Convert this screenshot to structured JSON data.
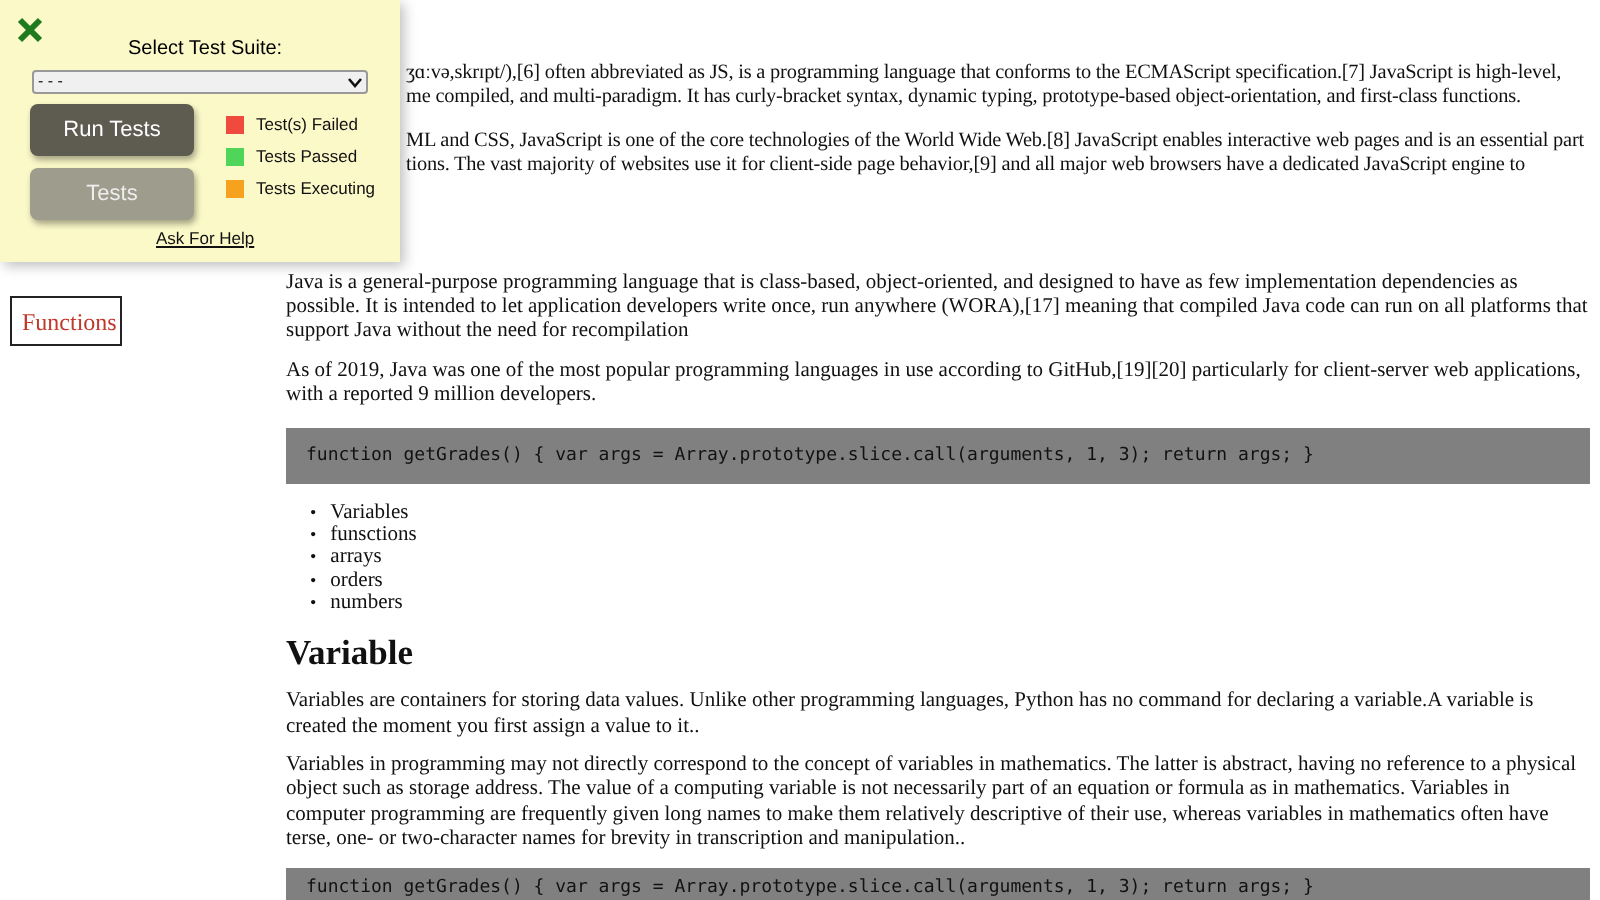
{
  "panel": {
    "title": "Select Test Suite:",
    "select": {
      "value": "- - -"
    },
    "buttons": [
      {
        "label": "Run Tests",
        "kind": "primary"
      },
      {
        "label": "Tests",
        "kind": "secondary"
      }
    ],
    "legend": [
      {
        "label": "Test(s) Failed",
        "color": "#f04a3e"
      },
      {
        "label": "Tests Passed",
        "color": "#4fd65a"
      },
      {
        "label": "Tests Executing",
        "color": "#f6a21e"
      }
    ],
    "help_link": "Ask For Help"
  },
  "sidebar": {
    "items": [
      {
        "label": "Functions"
      }
    ]
  },
  "intro": [
    {
      "lines": [
        "ʒɑːvə,skrɪpt/),[6] often abbreviated as JS, is a programming language that conforms to the ECMAScript specification.[7] JavaScript is high-level,",
        "me compiled, and multi-paradigm. It has curly-bracket syntax, dynamic typing, prototype-based object-orientation, and first-class functions."
      ]
    },
    {
      "lines": [
        "ML and CSS, JavaScript is one of the core technologies of the World Wide Web.[8] JavaScript enables interactive web pages and is an essential part",
        "tions. The vast majority of websites use it for client-side page behavior,[9] and all major web browsers have a dedicated JavaScript engine to"
      ]
    }
  ],
  "java": {
    "paragraphs": [
      "Java is a general-purpose programming language that is class-based, object-oriented, and designed to have as few implementation dependencies as possible. It is intended to let application developers write once, run anywhere (WORA),[17] meaning that compiled Java code can run on all platforms that support Java without the need for recompilation",
      "As of 2019, Java was one of the most popular programming languages in use according to GitHub,[19][20] particularly for client-server web applications, with a reported 9 million developers."
    ],
    "code": "function getGrades() { var args = Array.prototype.slice.call(arguments, 1, 3); return args; }",
    "list_marker": "•",
    "list": [
      "Variables",
      "funsctions",
      "arrays",
      "orders",
      "numbers"
    ]
  },
  "variable": {
    "heading": "Variable",
    "paragraphs": [
      "Variables are containers for storing data values. Unlike other programming languages, Python has no command for declaring a variable.A variable is created the moment you first assign a value to it..",
      "Variables in programming may not directly correspond to the concept of variables in mathematics. The latter is abstract, having no reference to a physical object such as storage address. The value of a computing variable is not necessarily part of an equation or formula as in mathematics. Variables in computer programming are frequently given long names to make them relatively descriptive of their use, whereas variables in mathematics often have terse, one- or two-character names for brevity in transcription and manipulation.."
    ],
    "code": "function getGrades() { var args = Array.prototype.slice.call(arguments, 1, 3); return args; }"
  }
}
